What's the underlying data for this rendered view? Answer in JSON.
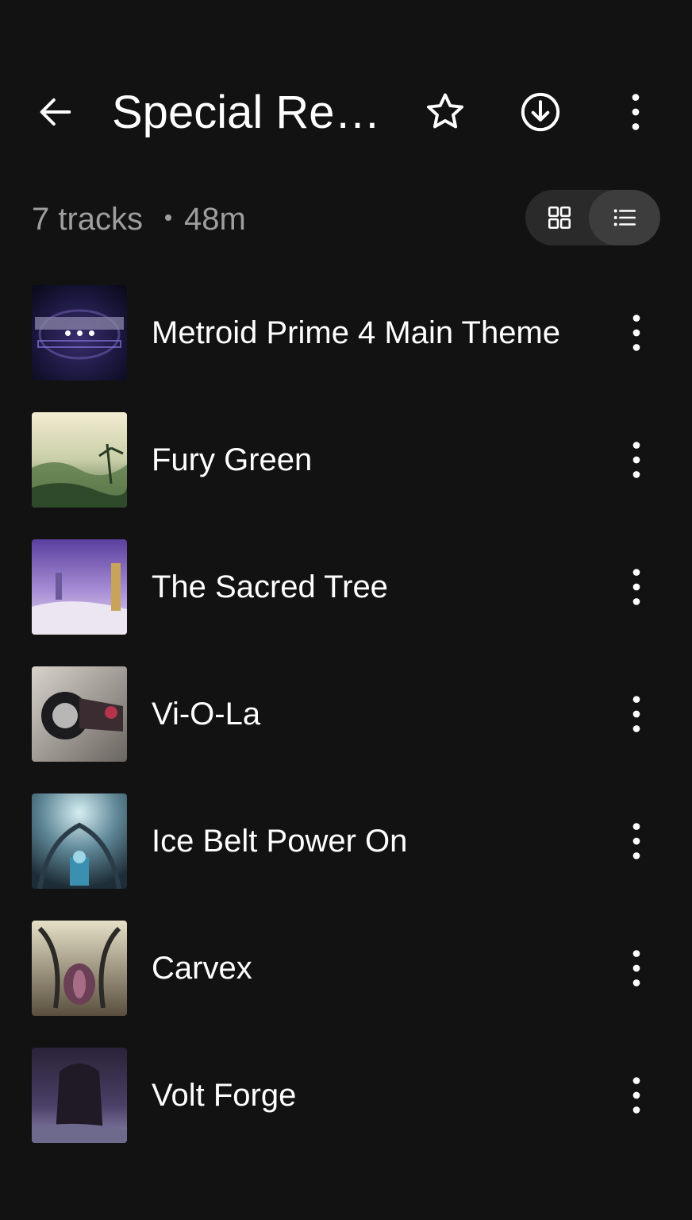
{
  "header": {
    "title": "Special Rel...",
    "back_icon": "arrow-left-icon",
    "favorite_icon": "star-outline-icon",
    "download_icon": "download-circle-icon",
    "more_icon": "more-vertical-icon"
  },
  "summary": {
    "tracks": "7 tracks",
    "duration": "48m"
  },
  "view_toggle": {
    "options": [
      "grid",
      "list"
    ],
    "selected": "list"
  },
  "tracks": [
    {
      "title": "Metroid Prime 4 Main Theme",
      "art": "metroid-logo-art",
      "playing_indicator": true
    },
    {
      "title": "Fury Green",
      "art": "jungle-art"
    },
    {
      "title": "The Sacred Tree",
      "art": "purple-figures-art"
    },
    {
      "title": "Vi-O-La",
      "art": "bike-art"
    },
    {
      "title": "Ice Belt Power On",
      "art": "ice-hall-art"
    },
    {
      "title": "Carvex",
      "art": "carvex-art"
    },
    {
      "title": "Volt Forge",
      "art": "volt-forge-art"
    }
  ],
  "colors": {
    "background": "#121212",
    "text_primary": "#ffffff",
    "text_secondary": "#9e9e9e",
    "toggle_bg": "#2a2a2a",
    "toggle_selected": "#3d3d3d"
  }
}
